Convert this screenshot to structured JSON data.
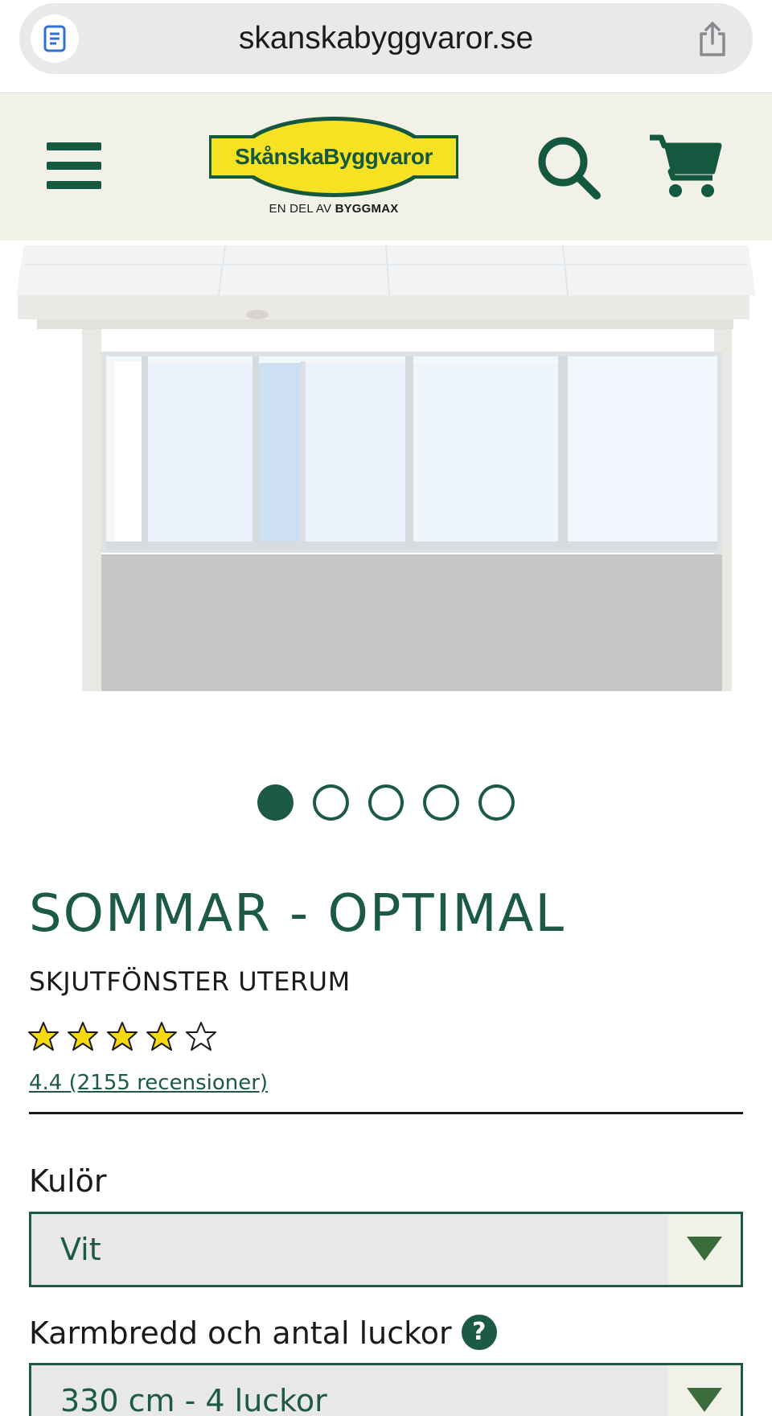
{
  "browser": {
    "url": "skanskabyggvaror.se",
    "reader_icon": "reader-icon",
    "share_icon": "share-icon"
  },
  "header": {
    "menu_icon": "hamburger-menu-icon",
    "logo_text": "SkånskaByggvaror",
    "logo_sub_prefix": "EN DEL AV ",
    "logo_sub_brand": "BYGGMAX",
    "search_icon": "search-icon",
    "cart_icon": "cart-icon",
    "brand_color": "#14583f",
    "logo_yellow": "#f6e223",
    "header_bg": "#f1f1e8"
  },
  "gallery": {
    "slide_count": 5,
    "active_index": 0
  },
  "product": {
    "title": "SOMMAR - OPTIMAL",
    "subtitle": "SKJUTFÖNSTER UTERUM",
    "rating_value": 4.4,
    "stars_filled": 4,
    "stars_total": 5,
    "rating_text": "4.4 (2155 recensioner)",
    "accent_color": "#1c5a45"
  },
  "options": {
    "color_label": "Kulör",
    "color_value": "Vit",
    "width_label": "Karmbredd och antal luckor",
    "width_help_icon": "question-icon",
    "width_value": "330 cm - 4 luckor"
  }
}
